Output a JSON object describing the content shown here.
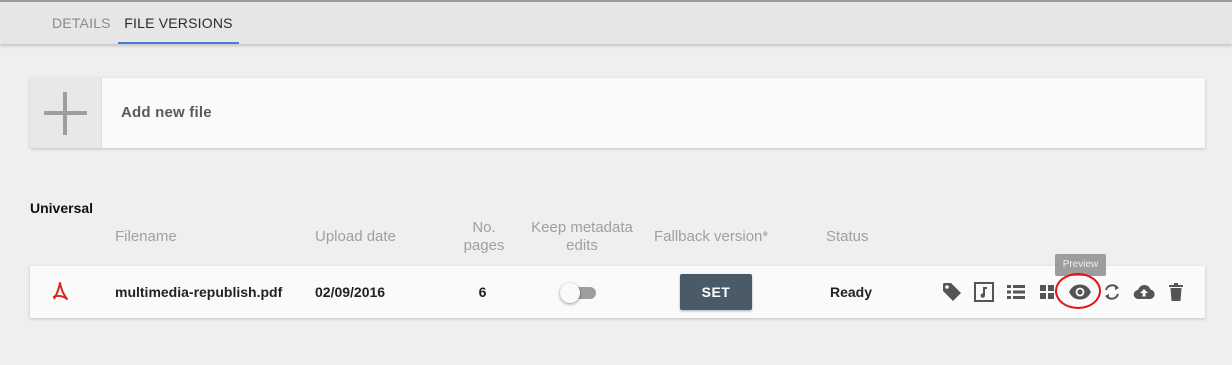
{
  "tabs": [
    {
      "label": "DETAILS"
    },
    {
      "label": "FILE VERSIONS",
      "active": true
    }
  ],
  "add_file": {
    "label": "Add new file",
    "icon": "plus-icon"
  },
  "section": {
    "title": "Universal"
  },
  "columns": {
    "filename": "Filename",
    "upload_date": "Upload date",
    "pages_line1": "No.",
    "pages_line2": "pages",
    "keep_line1": "Keep metadata",
    "keep_line2": "edits",
    "fallback": "Fallback version*",
    "status": "Status"
  },
  "file_row": {
    "file_icon": "pdf-icon",
    "filename": "multimedia-republish.pdf",
    "upload_date": "02/09/2016",
    "pages": "6",
    "keep_metadata_edits": false,
    "fallback_button": "SET",
    "status": "Ready",
    "actions": [
      "tag-icon",
      "music-note-icon",
      "list-view-icon",
      "grid-view-icon",
      "eye-icon",
      "refresh-icon",
      "cloud-upload-icon",
      "trash-icon"
    ]
  },
  "tooltip": {
    "text": "Preview"
  },
  "colors": {
    "tab_underline": "#4a7bd8",
    "pdf_icon": "#d52b1e",
    "set_button": "#4a5a66",
    "highlight_ring": "#e01515"
  }
}
